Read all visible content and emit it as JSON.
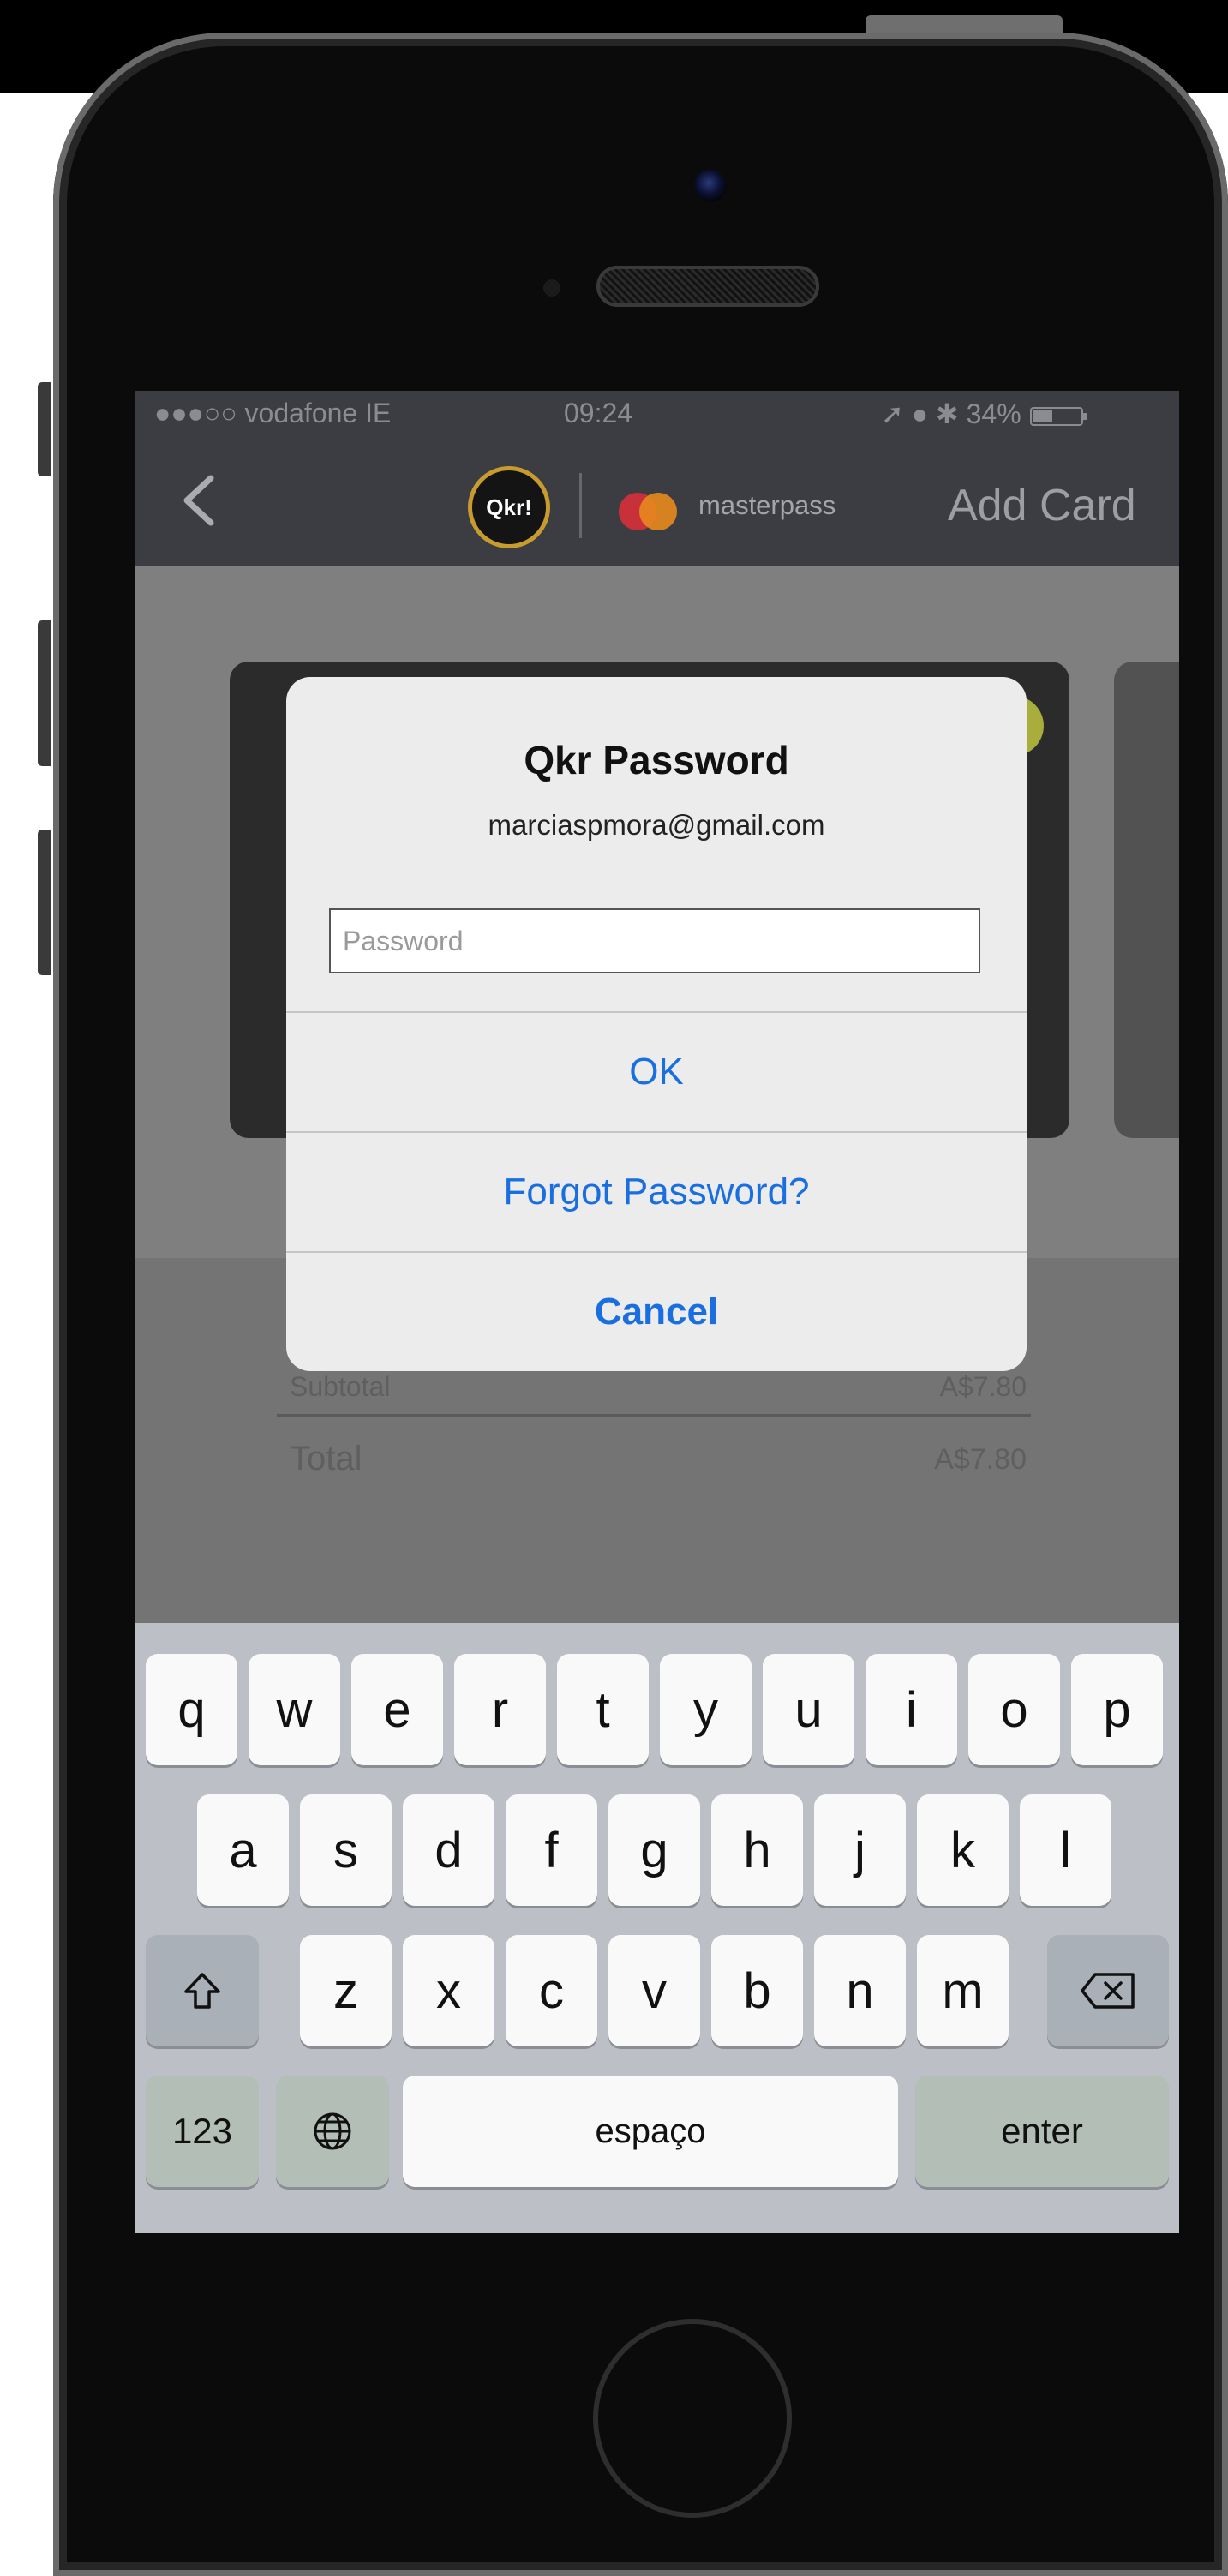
{
  "status_bar": {
    "carrier": "●●●○○ vodafone IE",
    "time": "09:24",
    "battery": "34%"
  },
  "nav": {
    "qkr_logo": "Qkr!",
    "masterpass": "masterpass",
    "add_card": "Add Card",
    "back_icon": "chevron-left-icon"
  },
  "summary": {
    "subtotal_label": "Subtotal",
    "subtotal_value": "A$7.80",
    "total_label": "Total",
    "total_value": "A$7.80"
  },
  "alert": {
    "title": "Qkr Password",
    "email": "marciaspmora@gmail.com",
    "password_placeholder": "Password",
    "ok": "OK",
    "forgot": "Forgot Password?",
    "cancel": "Cancel"
  },
  "keyboard": {
    "row1": [
      "q",
      "w",
      "e",
      "r",
      "t",
      "y",
      "u",
      "i",
      "o",
      "p"
    ],
    "row2": [
      "a",
      "s",
      "d",
      "f",
      "g",
      "h",
      "j",
      "k",
      "l"
    ],
    "row3": [
      "z",
      "x",
      "c",
      "v",
      "b",
      "n",
      "m"
    ],
    "numbers": "123",
    "space": "espaço",
    "enter": "enter",
    "shift_icon": "shift-icon",
    "delete_icon": "delete-icon",
    "globe_icon": "globe-icon"
  },
  "colors": {
    "alert_button": "#1a6fe0",
    "nav_background": "#3b3d42",
    "qkr_ring": "#c89b2d"
  }
}
